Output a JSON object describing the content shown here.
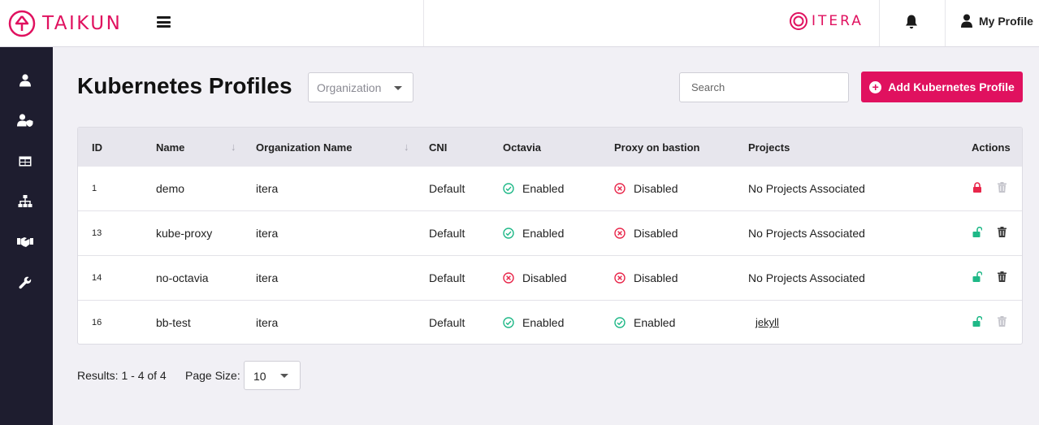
{
  "header": {
    "brand_name": "TAIKUN",
    "partner_name": "ITERA",
    "profile_label": "My Profile",
    "brand_color": "#e0115f"
  },
  "sidebar": {
    "items": [
      {
        "icon": "user-icon"
      },
      {
        "icon": "user-shield-icon"
      },
      {
        "icon": "table-icon"
      },
      {
        "icon": "sitemap-icon"
      },
      {
        "icon": "handshake-icon"
      },
      {
        "icon": "wrench-icon"
      }
    ]
  },
  "page": {
    "title": "Kubernetes Profiles",
    "org_placeholder": "Organization",
    "search_placeholder": "Search",
    "add_button_label": "Add Kubernetes Profile"
  },
  "table": {
    "columns": [
      "ID",
      "Name",
      "Organization Name",
      "CNI",
      "Octavia",
      "Proxy on bastion",
      "Projects",
      "Actions"
    ],
    "rows": [
      {
        "id": "1",
        "name": "demo",
        "org": "itera",
        "cni": "Default",
        "octavia": "Enabled",
        "proxy": "Disabled",
        "projects": "No Projects Associated",
        "locked": true,
        "delete_enabled": false
      },
      {
        "id": "13",
        "name": "kube-proxy",
        "org": "itera",
        "cni": "Default",
        "octavia": "Enabled",
        "proxy": "Disabled",
        "projects": "No Projects Associated",
        "locked": false,
        "delete_enabled": true
      },
      {
        "id": "14",
        "name": "no-octavia",
        "org": "itera",
        "cni": "Default",
        "octavia": "Disabled",
        "proxy": "Disabled",
        "projects": "No Projects Associated",
        "locked": false,
        "delete_enabled": true
      },
      {
        "id": "16",
        "name": "bb-test",
        "org": "itera",
        "cni": "Default",
        "octavia": "Enabled",
        "proxy": "Enabled",
        "projects": "jekyll",
        "locked": false,
        "delete_enabled": false
      }
    ],
    "enabled_color": "#1fb887",
    "disabled_color": "#e8264a"
  },
  "footer": {
    "results_text": "Results: 1 - 4 of 4",
    "page_size_label": "Page Size:",
    "page_size_value": "10"
  }
}
